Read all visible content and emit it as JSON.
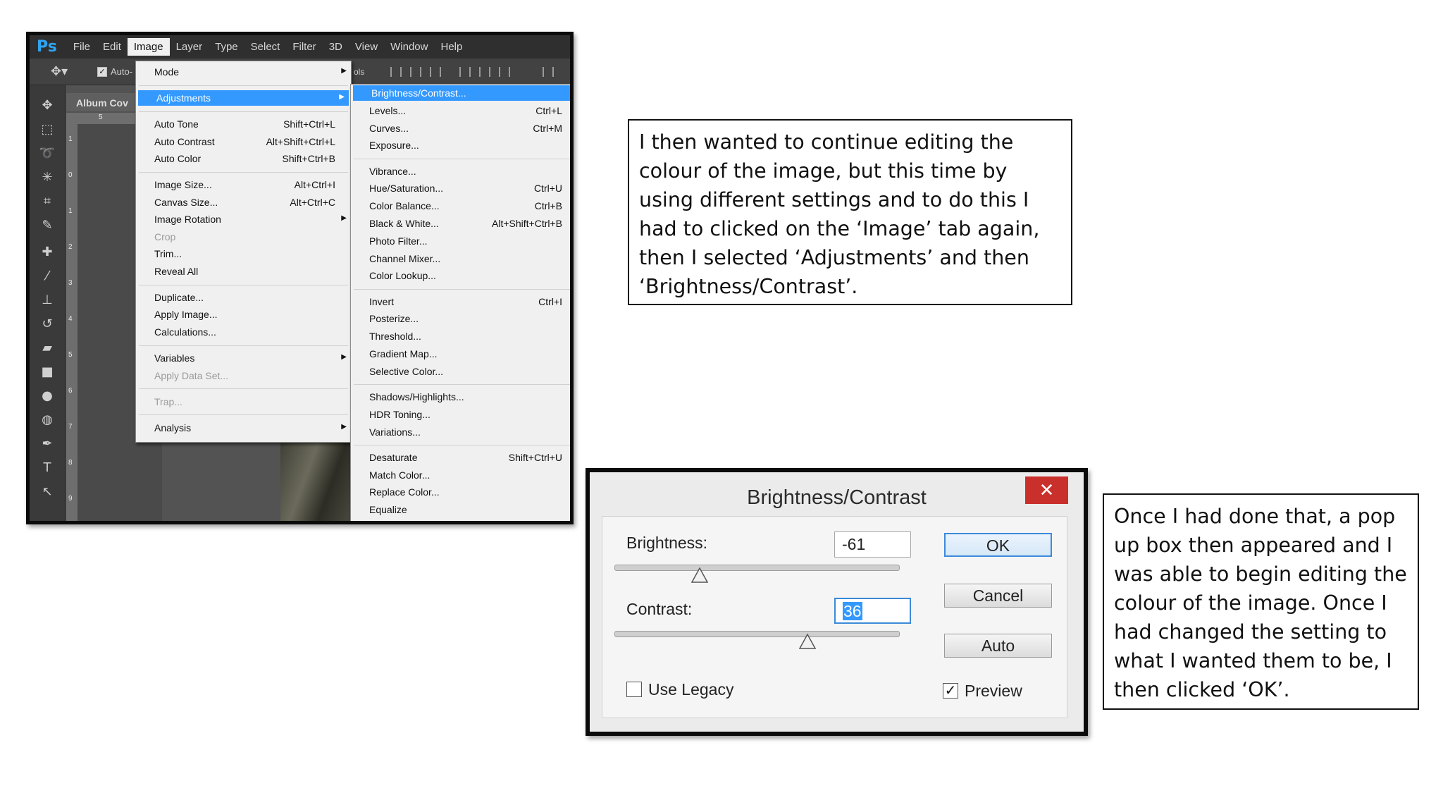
{
  "photoshop": {
    "logo": "Ps",
    "menubar": [
      "File",
      "Edit",
      "Image",
      "Layer",
      "Type",
      "Select",
      "Filter",
      "3D",
      "View",
      "Window",
      "Help"
    ],
    "active_menu": "Image",
    "options": {
      "auto_label": "Auto-",
      "ols": "ols"
    },
    "document_tab": "Album Cov",
    "ruler_top": "5",
    "ruler_left": [
      "1",
      "0",
      "1",
      "2",
      "3",
      "4",
      "5",
      "6",
      "7",
      "8",
      "9"
    ],
    "image_menu": [
      {
        "label": "Mode",
        "shortcut": "",
        "submenu": true,
        "disabled": false
      },
      {
        "sep": true
      },
      {
        "label": "Adjustments",
        "shortcut": "",
        "submenu": true,
        "disabled": false,
        "highlight": true
      },
      {
        "sep": true
      },
      {
        "label": "Auto Tone",
        "shortcut": "Shift+Ctrl+L",
        "disabled": false
      },
      {
        "label": "Auto Contrast",
        "shortcut": "Alt+Shift+Ctrl+L",
        "disabled": false
      },
      {
        "label": "Auto Color",
        "shortcut": "Shift+Ctrl+B",
        "disabled": false
      },
      {
        "sep": true
      },
      {
        "label": "Image Size...",
        "shortcut": "Alt+Ctrl+I",
        "disabled": false
      },
      {
        "label": "Canvas Size...",
        "shortcut": "Alt+Ctrl+C",
        "disabled": false
      },
      {
        "label": "Image Rotation",
        "shortcut": "",
        "submenu": true,
        "disabled": false
      },
      {
        "label": "Crop",
        "shortcut": "",
        "disabled": true
      },
      {
        "label": "Trim...",
        "shortcut": "",
        "disabled": false
      },
      {
        "label": "Reveal All",
        "shortcut": "",
        "disabled": false
      },
      {
        "sep": true
      },
      {
        "label": "Duplicate...",
        "shortcut": "",
        "disabled": false
      },
      {
        "label": "Apply Image...",
        "shortcut": "",
        "disabled": false
      },
      {
        "label": "Calculations...",
        "shortcut": "",
        "disabled": false
      },
      {
        "sep": true
      },
      {
        "label": "Variables",
        "shortcut": "",
        "submenu": true,
        "disabled": false
      },
      {
        "label": "Apply Data Set...",
        "shortcut": "",
        "disabled": true
      },
      {
        "sep": true
      },
      {
        "label": "Trap...",
        "shortcut": "",
        "disabled": true
      },
      {
        "sep": true
      },
      {
        "label": "Analysis",
        "shortcut": "",
        "submenu": true,
        "disabled": false
      }
    ],
    "adjustments_menu": [
      {
        "label": "Brightness/Contrast...",
        "shortcut": "",
        "highlight": true
      },
      {
        "label": "Levels...",
        "shortcut": "Ctrl+L"
      },
      {
        "label": "Curves...",
        "shortcut": "Ctrl+M"
      },
      {
        "label": "Exposure...",
        "shortcut": ""
      },
      {
        "sep": true
      },
      {
        "label": "Vibrance...",
        "shortcut": ""
      },
      {
        "label": "Hue/Saturation...",
        "shortcut": "Ctrl+U"
      },
      {
        "label": "Color Balance...",
        "shortcut": "Ctrl+B"
      },
      {
        "label": "Black & White...",
        "shortcut": "Alt+Shift+Ctrl+B"
      },
      {
        "label": "Photo Filter...",
        "shortcut": ""
      },
      {
        "label": "Channel Mixer...",
        "shortcut": ""
      },
      {
        "label": "Color Lookup...",
        "shortcut": ""
      },
      {
        "sep": true
      },
      {
        "label": "Invert",
        "shortcut": "Ctrl+I"
      },
      {
        "label": "Posterize...",
        "shortcut": ""
      },
      {
        "label": "Threshold...",
        "shortcut": ""
      },
      {
        "label": "Gradient Map...",
        "shortcut": ""
      },
      {
        "label": "Selective Color...",
        "shortcut": ""
      },
      {
        "sep": true
      },
      {
        "label": "Shadows/Highlights...",
        "shortcut": ""
      },
      {
        "label": "HDR Toning...",
        "shortcut": ""
      },
      {
        "label": "Variations...",
        "shortcut": ""
      },
      {
        "sep": true
      },
      {
        "label": "Desaturate",
        "shortcut": "Shift+Ctrl+U"
      },
      {
        "label": "Match Color...",
        "shortcut": ""
      },
      {
        "label": "Replace Color...",
        "shortcut": ""
      },
      {
        "label": "Equalize",
        "shortcut": ""
      }
    ]
  },
  "dialog": {
    "title": "Brightness/Contrast",
    "close_glyph": "✕",
    "brightness_label": "Brightness:",
    "brightness_value": "-61",
    "brightness_fraction": 0.3,
    "contrast_label": "Contrast:",
    "contrast_value": "36",
    "contrast_fraction": 0.68,
    "ok": "OK",
    "cancel": "Cancel",
    "auto": "Auto",
    "use_legacy": "Use Legacy",
    "use_legacy_checked": false,
    "preview": "Preview",
    "preview_checked": true
  },
  "notes": {
    "top": "I then wanted to continue editing the colour of the image, but this time by using different settings and to do this I had to clicked on the ‘Image’ tab again, then I selected ‘Adjustments’ and then ‘Brightness/Contrast’.",
    "bottom": "Once I had done that, a pop up box then appeared and I was able to begin editing the colour of the image. Once I had changed the setting to what I wanted them to be, I then clicked ‘OK’."
  },
  "colors": {
    "highlight": "#3399ff",
    "close_red": "#c9302c",
    "ps_blue": "#2fa4f0"
  }
}
